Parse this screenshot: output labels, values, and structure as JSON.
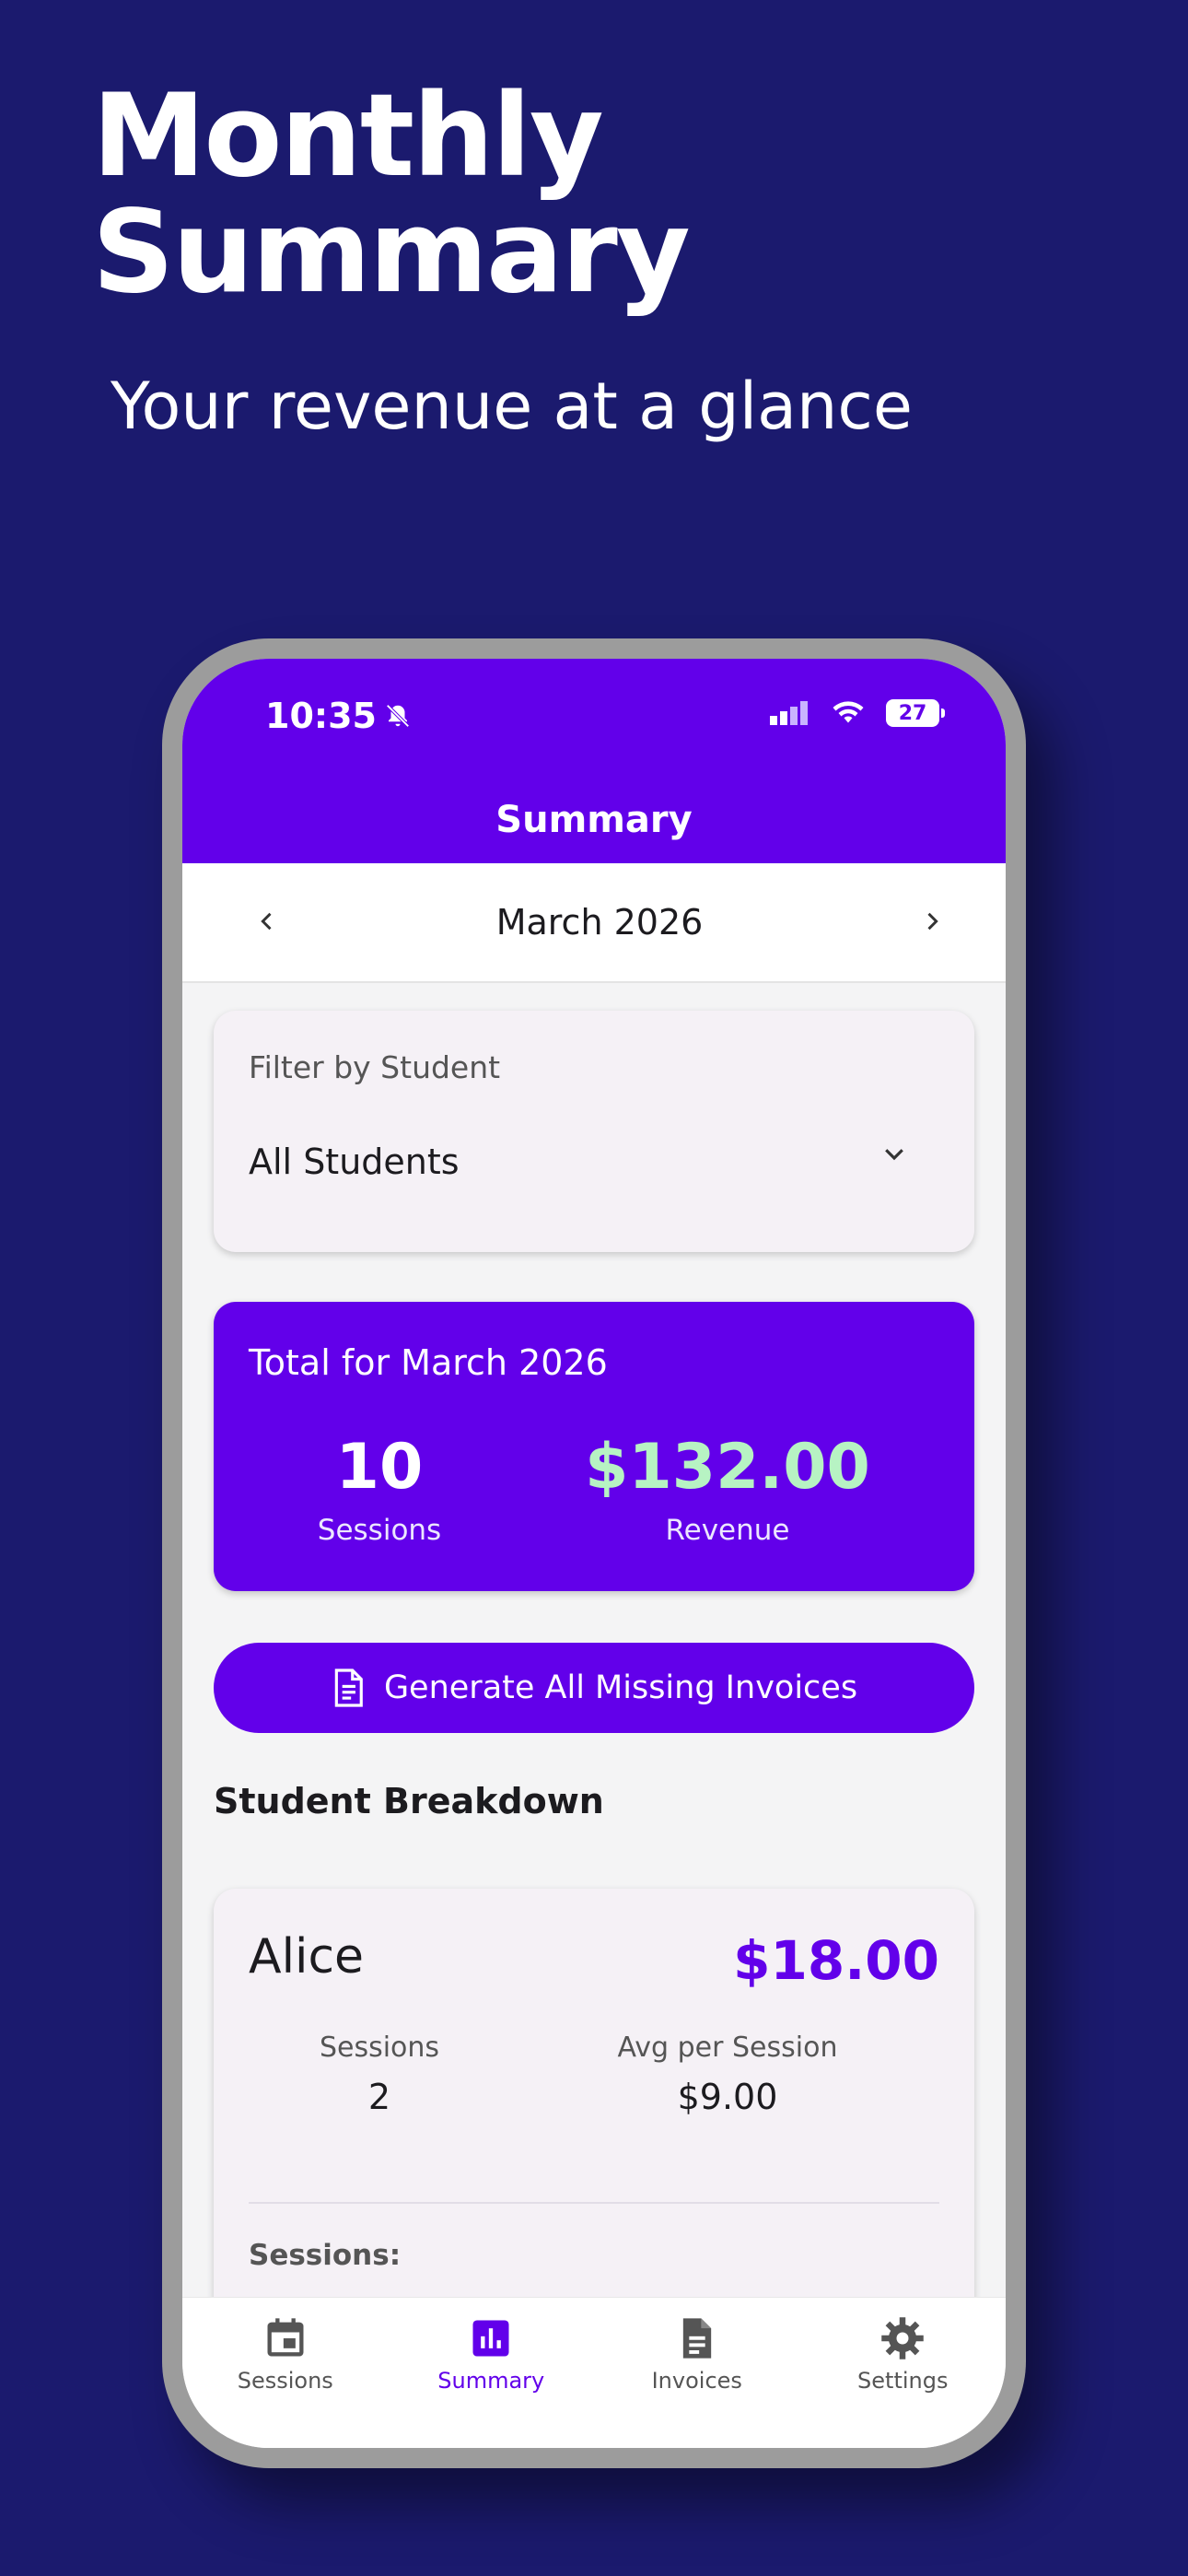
{
  "hero": {
    "title": "Monthly Summary",
    "subtitle": "Your revenue at a glance"
  },
  "status_bar": {
    "time": "10:35",
    "battery": "27"
  },
  "appbar": {
    "title": "Summary"
  },
  "month_nav": {
    "label": "March 2026"
  },
  "filter": {
    "label": "Filter by Student",
    "value": "All Students"
  },
  "totals": {
    "title": "Total for March 2026",
    "sessions_value": "10",
    "sessions_label": "Sessions",
    "revenue_value": "$132.00",
    "revenue_label": "Revenue",
    "revenue_color": "#b7f3c3"
  },
  "actions": {
    "generate_label": "Generate All Missing Invoices"
  },
  "breakdown": {
    "title": "Student Breakdown",
    "students": [
      {
        "name": "Alice",
        "amount": "$18.00",
        "sessions_label": "Sessions",
        "sessions_value": "2",
        "avg_label": "Avg per Session",
        "avg_value": "$9.00",
        "sessions_list_label": "Sessions:"
      }
    ]
  },
  "bottom_nav": {
    "items": [
      {
        "label": "Sessions",
        "icon": "calendar-icon"
      },
      {
        "label": "Summary",
        "icon": "bar-chart-icon",
        "active": true
      },
      {
        "label": "Invoices",
        "icon": "document-icon"
      },
      {
        "label": "Settings",
        "icon": "gear-icon"
      }
    ]
  },
  "colors": {
    "background": "#1b1a6e",
    "accent": "#6200ea",
    "surface": "#f5f1f6"
  }
}
